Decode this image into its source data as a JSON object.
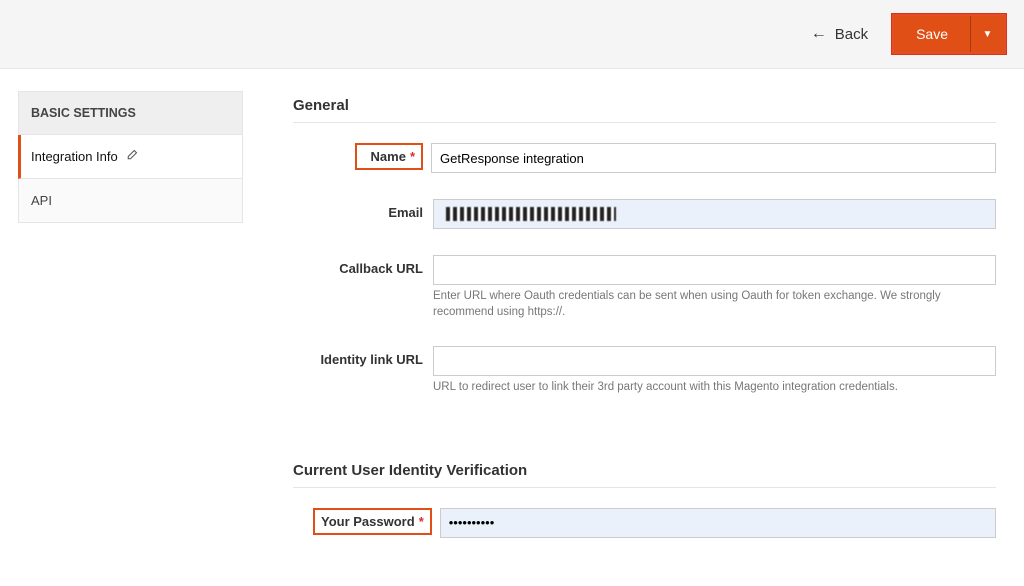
{
  "toolbar": {
    "back_label": "Back",
    "save_label": "Save"
  },
  "sidebar": {
    "header": "BASIC SETTINGS",
    "items": [
      {
        "label": "Integration Info",
        "active": true,
        "has_edit_icon": true
      },
      {
        "label": "API",
        "active": false,
        "has_edit_icon": false
      }
    ]
  },
  "sections": {
    "general": {
      "title": "General",
      "fields": {
        "name": {
          "label": "Name",
          "required": true,
          "value": "GetResponse integration"
        },
        "email": {
          "label": "Email",
          "value": ""
        },
        "callback_url": {
          "label": "Callback URL",
          "value": "",
          "hint": "Enter URL where Oauth credentials can be sent when using Oauth for token exchange. We strongly recommend using https://."
        },
        "identity_link_url": {
          "label": "Identity link URL",
          "value": "",
          "hint": "URL to redirect user to link their 3rd party account with this Magento integration credentials."
        }
      }
    },
    "verification": {
      "title": "Current User Identity Verification",
      "fields": {
        "password": {
          "label": "Your Password",
          "required": true,
          "value": "••••••••••"
        }
      }
    }
  },
  "colors": {
    "accent": "#e04f15",
    "highlight_border": "#e04f15"
  }
}
